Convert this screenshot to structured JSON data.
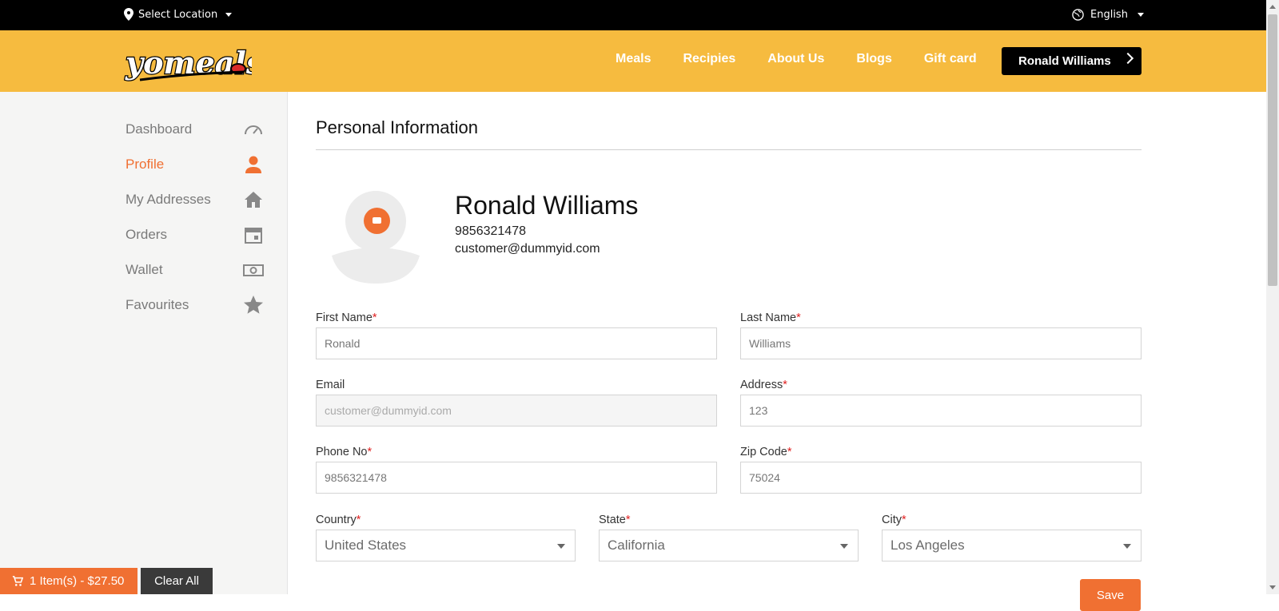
{
  "topbar": {
    "location_label": "Select Location",
    "language_label": "English"
  },
  "header": {
    "logo_text": "yomeals",
    "nav": [
      "Meals",
      "Recipies",
      "About Us",
      "Blogs",
      "Gift card"
    ],
    "user_button": "Ronald Williams"
  },
  "sidebar": {
    "items": [
      {
        "label": "Dashboard",
        "icon": "speedometer-icon"
      },
      {
        "label": "Profile",
        "icon": "person-icon",
        "active": true
      },
      {
        "label": "My Addresses",
        "icon": "home-icon"
      },
      {
        "label": "Orders",
        "icon": "calendar-icon"
      },
      {
        "label": "Wallet",
        "icon": "money-icon"
      },
      {
        "label": "Favourites",
        "icon": "star-icon"
      }
    ]
  },
  "profile": {
    "section_title": "Personal Information",
    "name": "Ronald Williams",
    "phone": "9856321478",
    "email": "customer@dummyid.com"
  },
  "form": {
    "first_name_label": "First Name",
    "first_name_value": "Ronald",
    "last_name_label": "Last Name",
    "last_name_value": "Williams",
    "email_label": "Email",
    "email_value": "customer@dummyid.com",
    "address_label": "Address",
    "address_value": "123",
    "phone_label": "Phone No",
    "phone_value": "9856321478",
    "zip_label": "Zip Code",
    "zip_value": "75024",
    "country_label": "Country",
    "country_value": "United States",
    "state_label": "State",
    "state_value": "California",
    "city_label": "City",
    "city_value": "Los Angeles",
    "required_mark": "*",
    "save_label": "Save"
  },
  "cart": {
    "summary": "1 Item(s) - $27.50",
    "clear_label": "Clear All"
  },
  "colors": {
    "accent": "#f07032",
    "header_bg": "#f6bb3f",
    "topbar_bg": "#000000"
  }
}
